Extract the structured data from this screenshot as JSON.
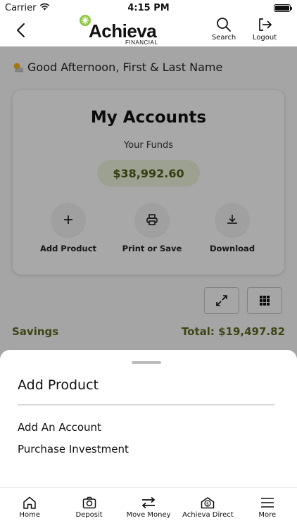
{
  "status_bar": {
    "carrier": "Carrier",
    "time": "4:15 PM",
    "battery_level": 1.0
  },
  "header": {
    "logo_text": "Achieva",
    "logo_subtext": "FINANCIAL",
    "search_label": "Search",
    "logout_label": "Logout"
  },
  "greeting": "Good Afternoon, First & Last Name",
  "accounts_card": {
    "title": "My Accounts",
    "subtitle": "Your Funds",
    "funds": "$38,992.60",
    "actions": [
      {
        "label": "Add Product",
        "icon": "plus-icon"
      },
      {
        "label": "Print or Save",
        "icon": "printer-icon"
      },
      {
        "label": "Download",
        "icon": "download-icon"
      }
    ]
  },
  "savings": {
    "label": "Savings",
    "total": "Total: $19,497.82"
  },
  "sheet": {
    "title": "Add Product",
    "items": [
      "Add An Account",
      "Purchase Investment"
    ]
  },
  "tabs": [
    {
      "label": "Home",
      "icon": "home-icon"
    },
    {
      "label": "Deposit",
      "icon": "camera-icon"
    },
    {
      "label": "Move Money",
      "icon": "transfer-icon"
    },
    {
      "label": "Achieva Direct",
      "icon": "money-bag-icon"
    },
    {
      "label": "More",
      "icon": "menu-icon"
    }
  ],
  "colors": {
    "brand_green": "#8cc63f",
    "funds_text": "#4d5b1a",
    "savings_text": "#5a661f"
  }
}
